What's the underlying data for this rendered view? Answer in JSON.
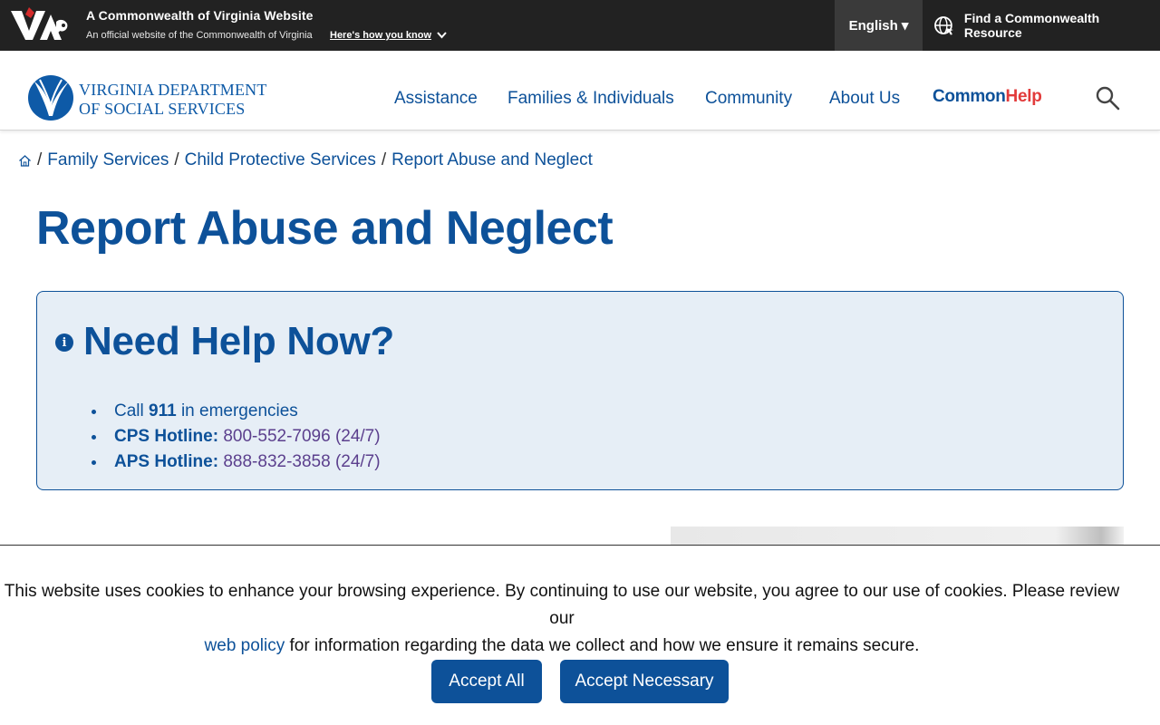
{
  "topbar": {
    "title": "A Commonwealth of Virginia Website",
    "subtitle": "An official website of the Commonwealth of Virginia",
    "how_know": "Here's how you know",
    "language": "English",
    "resource": "Find a Commonwealth Resource"
  },
  "header": {
    "agency_line1": "VIRGINIA DEPARTMENT",
    "agency_line2": "OF SOCIAL SERVICES",
    "nav": [
      "Assistance",
      "Families & Individuals",
      "Community",
      "About Us"
    ],
    "common": "Common",
    "help": "Help"
  },
  "breadcrumb": {
    "items": [
      "Family Services",
      "Child Protective Services",
      "Report Abuse and Neglect"
    ]
  },
  "page": {
    "title": "Report Abuse and Neglect"
  },
  "alert": {
    "title": "Need Help Now?",
    "items": [
      {
        "pre": "Call ",
        "bold": "911",
        "post": " in emergencies"
      },
      {
        "label": "CPS Hotline:",
        "phone": "800-552-7096 (24/7)"
      },
      {
        "label": "APS Hotline:",
        "phone": "888-832-3858 (24/7)"
      }
    ]
  },
  "cookie": {
    "text_part1": "This website uses cookies to enhance your browsing experience. By continuing to use our website, you agree to our use of cookies. Please review our",
    "link": "web policy",
    "text_part2": "for information regarding the data we collect and how we ensure it remains secure.",
    "accept_all": "Accept All",
    "accept_necessary": "Accept Necessary"
  },
  "colors": {
    "brand_blue": "#0d5199",
    "help_red": "#e23b3b",
    "topbar_bg": "#222222"
  },
  "icons": {
    "home": "home-icon",
    "search": "search-icon",
    "globe": "globe-icon",
    "info": "info-icon",
    "chevron": "chevron-down-icon"
  }
}
